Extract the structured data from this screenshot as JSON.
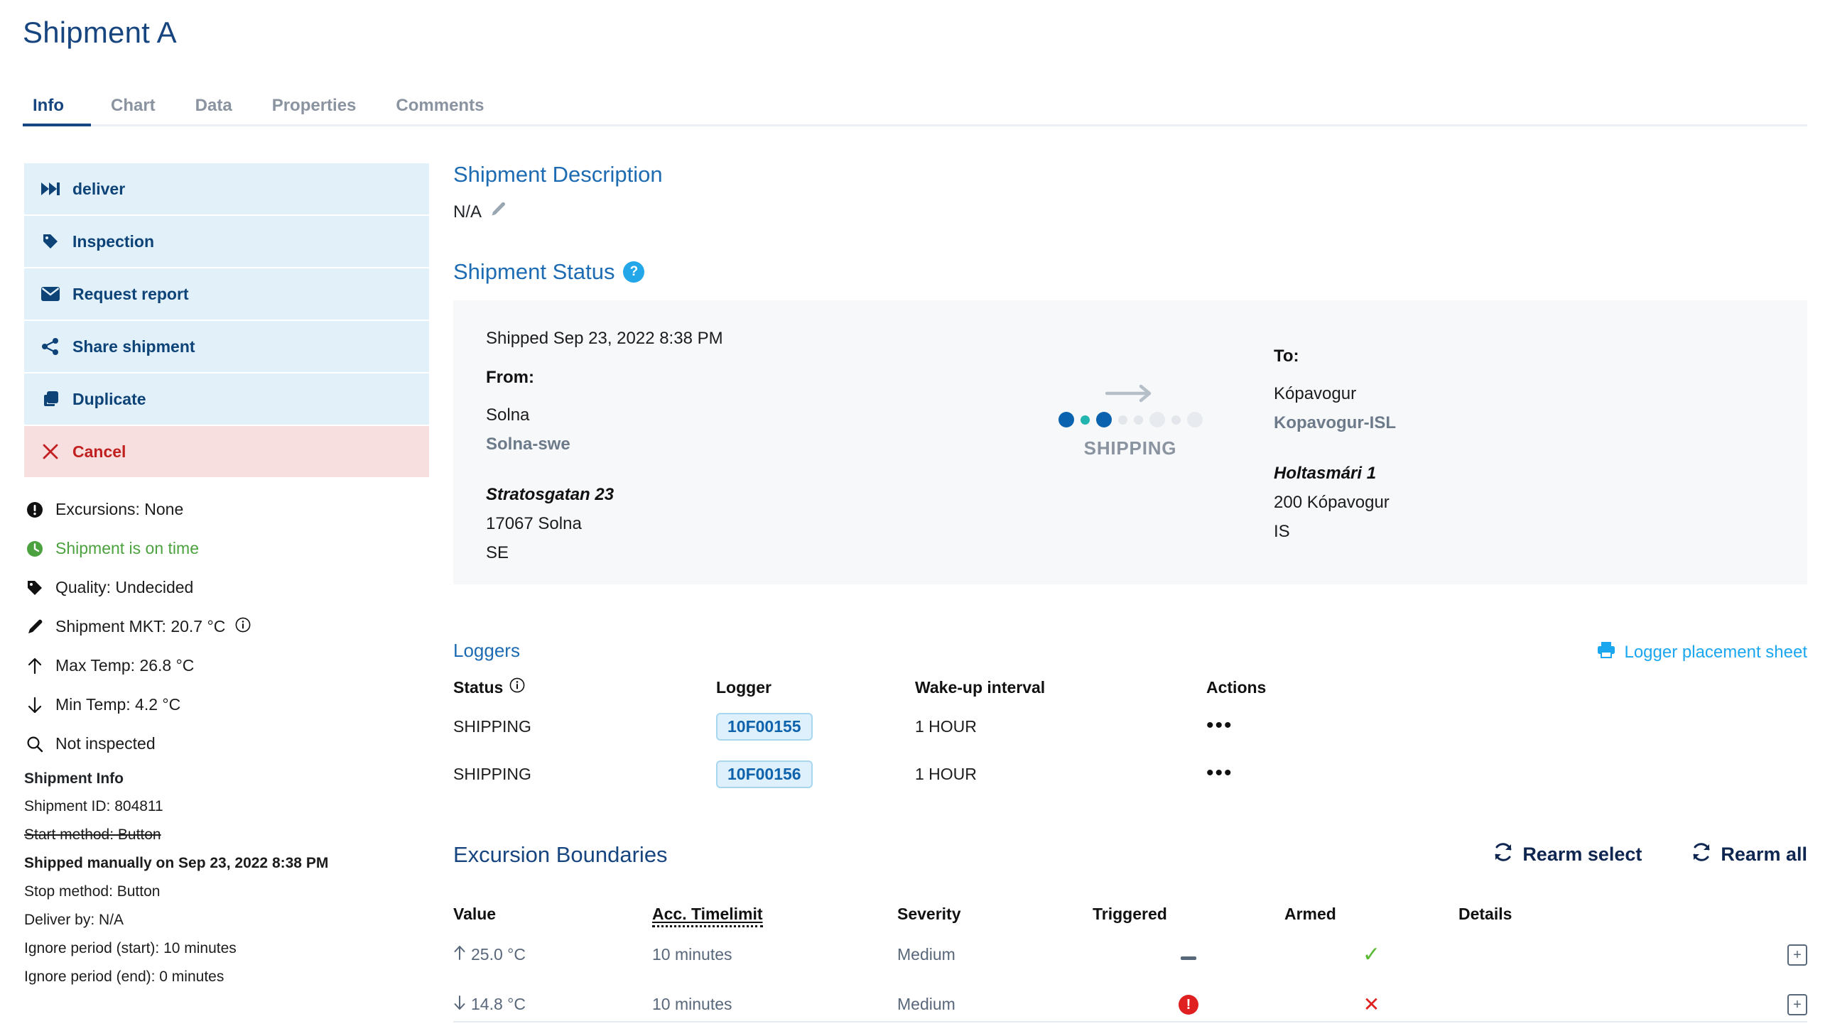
{
  "header": {
    "title": "Shipment A",
    "tabs": [
      {
        "label": "Info",
        "active": true
      },
      {
        "label": "Chart",
        "active": false
      },
      {
        "label": "Data",
        "active": false
      },
      {
        "label": "Properties",
        "active": false
      },
      {
        "label": "Comments",
        "active": false
      }
    ]
  },
  "sidebar": {
    "actions": [
      {
        "label": "deliver",
        "icon": "fast-forward-icon"
      },
      {
        "label": "Inspection",
        "icon": "tag-icon"
      },
      {
        "label": "Request report",
        "icon": "envelope-icon"
      },
      {
        "label": "Share shipment",
        "icon": "share-icon"
      },
      {
        "label": "Duplicate",
        "icon": "copy-icon"
      },
      {
        "label": "Cancel",
        "icon": "close-icon"
      }
    ],
    "status_items": [
      {
        "label": "Excursions: None",
        "icon": "exclamation-circle-icon"
      },
      {
        "label": "Shipment is on time",
        "icon": "clock-icon"
      },
      {
        "label": "Quality: Undecided",
        "icon": "tag-icon"
      },
      {
        "label": "Shipment MKT: 20.7 °C",
        "icon": "thermometer-icon"
      },
      {
        "label": "Max Temp: 26.8 °C",
        "icon": "arrow-up-icon"
      },
      {
        "label": "Min Temp: 4.2 °C",
        "icon": "arrow-down-icon"
      },
      {
        "label": "Not inspected",
        "icon": "magnifier-icon"
      }
    ],
    "shipment_info": {
      "heading": "Shipment Info",
      "lines": [
        "Shipment ID: 804811",
        "Start method: Button",
        "Shipped manually on Sep 23, 2022 8:38 PM",
        "Stop method: Button",
        "Deliver by: N/A",
        "Ignore period (start): 10 minutes",
        "Ignore period (end): 0 minutes"
      ]
    }
  },
  "main": {
    "description": {
      "title": "Shipment Description",
      "value": "N/A",
      "edit_icon": "pencil-icon"
    },
    "status": {
      "title": "Shipment Status",
      "help_badge": "?",
      "shipped_line": "Shipped Sep 23, 2022 8:38 PM",
      "from": {
        "label": "From:",
        "city": "Solna",
        "code": "Solna-swe",
        "street": "Stratosgatan 23",
        "postal": "17067 Solna",
        "country": "SE"
      },
      "to": {
        "label": "To:",
        "city": "Kópavogur",
        "code": "Kopavogur-ISL",
        "street": "Holtasmári 1",
        "postal": "200 Kópavogur",
        "country": "IS"
      },
      "progress_label": "SHIPPING",
      "progress_dots": [
        {
          "size": 22,
          "color": "#0b63b0"
        },
        {
          "size": 13,
          "color": "#22b5b0"
        },
        {
          "size": 22,
          "color": "#0b63b0"
        },
        {
          "size": 13,
          "color": "#e3e6ea"
        },
        {
          "size": 13,
          "color": "#e3e6ea"
        },
        {
          "size": 22,
          "color": "#e7eaee"
        },
        {
          "size": 13,
          "color": "#e3e6ea"
        },
        {
          "size": 22,
          "color": "#e7eaee"
        }
      ]
    },
    "loggers": {
      "title": "Loggers",
      "print_link": "Logger placement sheet",
      "print_icon": "printer-icon",
      "columns": [
        "Status",
        "Logger",
        "Wake-up interval",
        "Actions"
      ],
      "status_info_icon": "info-circle-icon",
      "rows": [
        {
          "status": "SHIPPING",
          "logger": "10F00155",
          "interval": "1 HOUR",
          "actions": "•••"
        },
        {
          "status": "SHIPPING",
          "logger": "10F00156",
          "interval": "1 HOUR",
          "actions": "•••"
        }
      ]
    },
    "excursions": {
      "title": "Excursion Boundaries",
      "rearm_select": "Rearm select",
      "rearm_all": "Rearm all",
      "rearm_icon": "refresh-icon",
      "columns": [
        "Value",
        "Acc. Timelimit",
        "Severity",
        "Triggered",
        "Armed",
        "Details"
      ],
      "rows": [
        {
          "direction": "up",
          "value": "25.0 °C",
          "timelimit": "10 minutes",
          "severity": "Medium",
          "triggered": "none",
          "armed": "yes",
          "details_icon": "expand-plus-icon"
        },
        {
          "direction": "down",
          "value": "14.8 °C",
          "timelimit": "10 minutes",
          "severity": "Medium",
          "triggered": "alert",
          "armed": "no",
          "details_icon": "expand-plus-icon"
        }
      ]
    }
  },
  "colors": {
    "brand_dark": "#17457f",
    "brand_link": "#1c6bb3",
    "action_bg": "#e1f0f9",
    "danger_bg": "#f7dfdf",
    "danger": "#c0201f",
    "green": "#4ba23e",
    "card_bg": "#f7f8fa",
    "cyan_link": "#1aa7ef"
  }
}
